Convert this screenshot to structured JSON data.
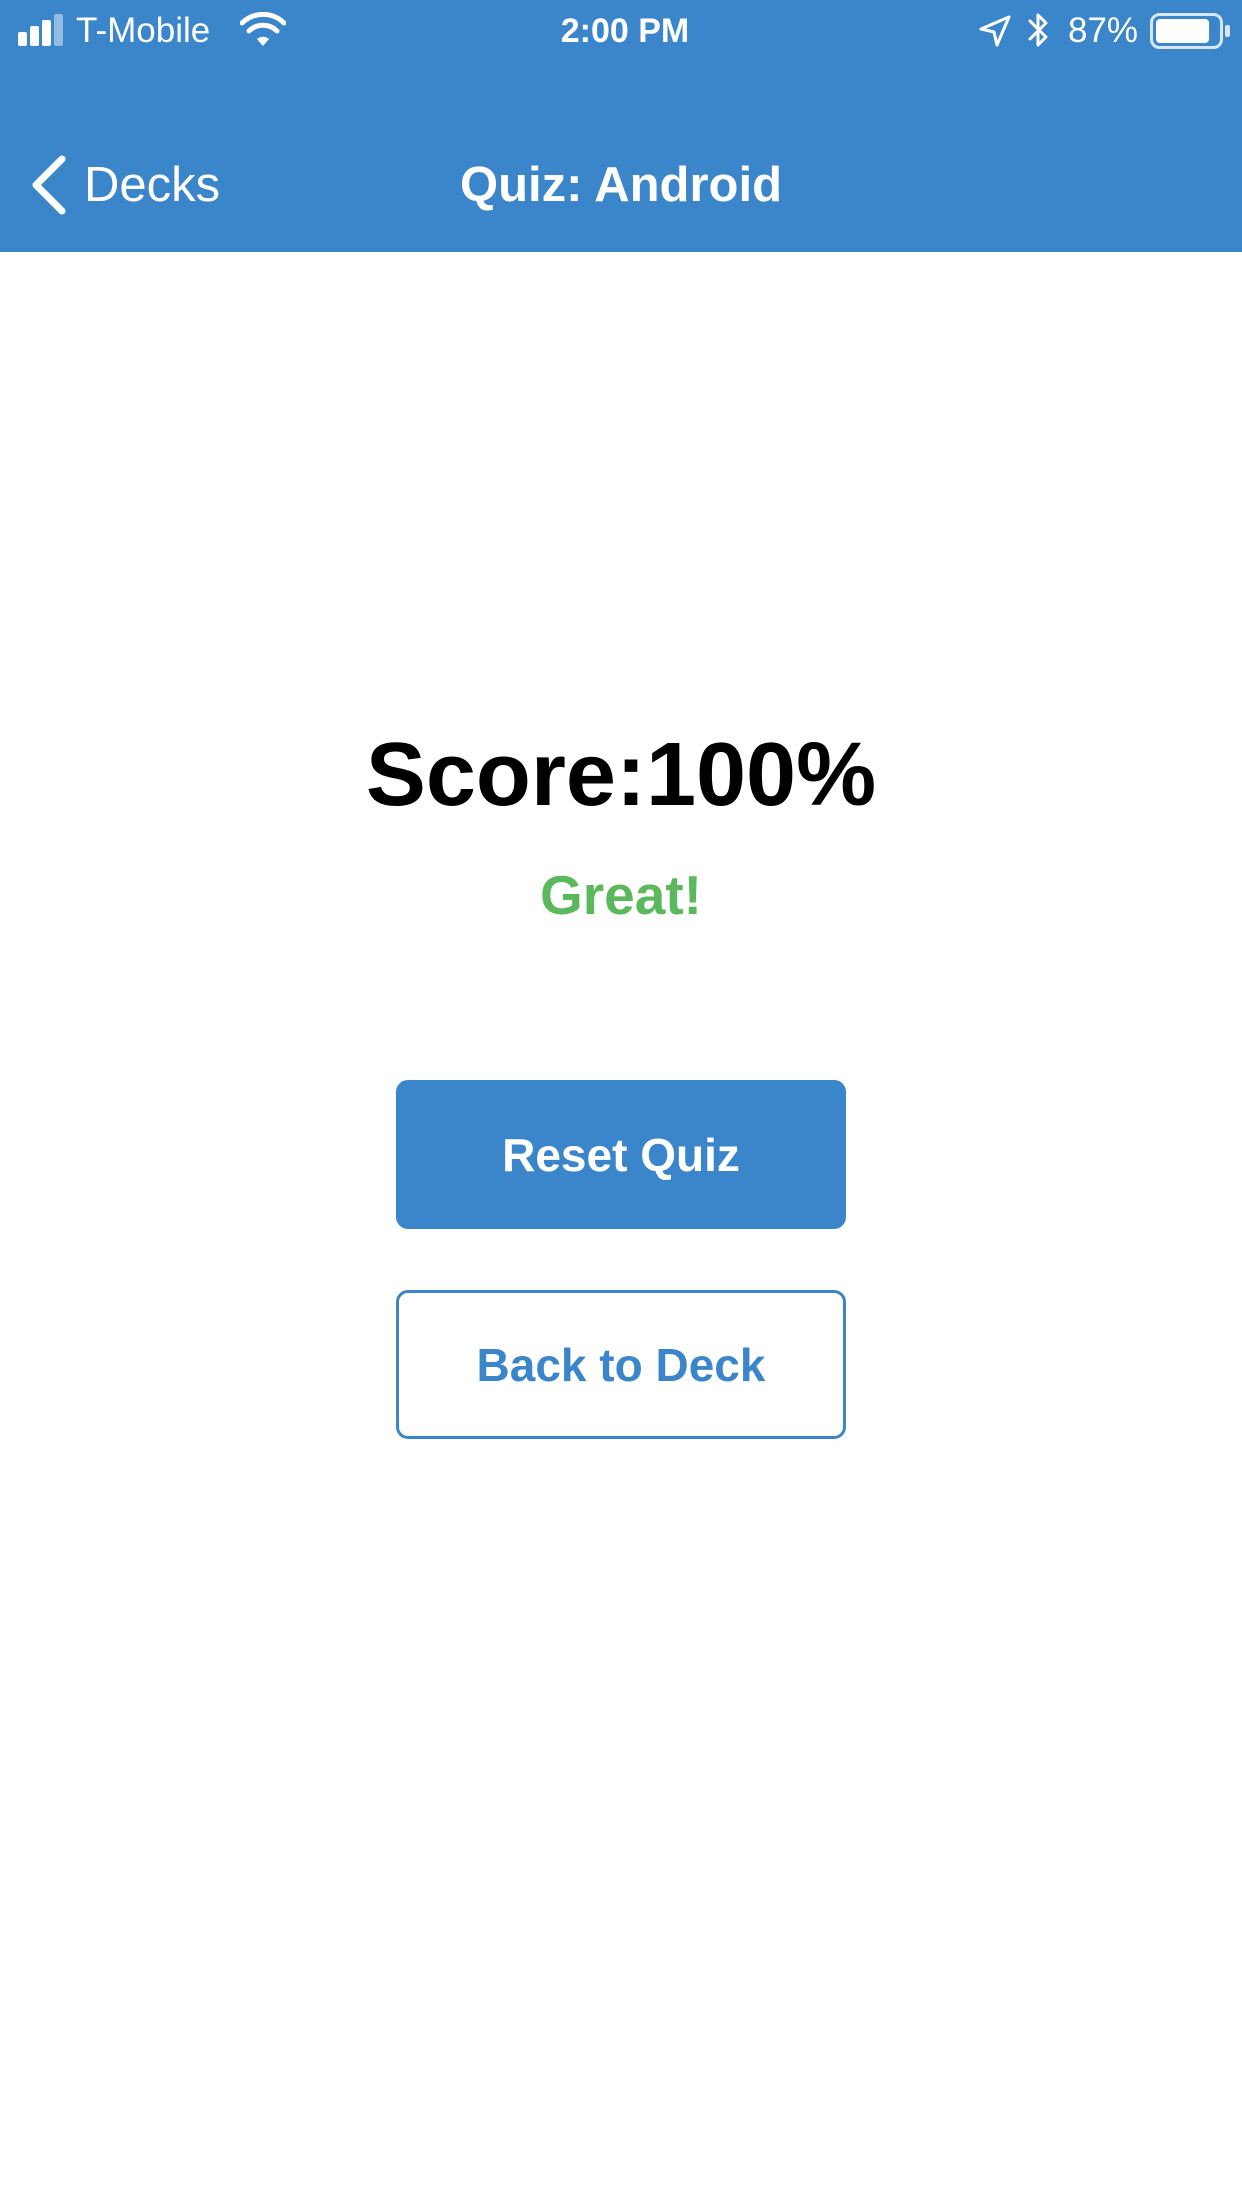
{
  "status_bar": {
    "carrier": "T-Mobile",
    "time": "2:00 PM",
    "battery_percent": "87%",
    "battery_level": 0.87,
    "icons": [
      "signal-icon",
      "wifi-icon",
      "location-icon",
      "bluetooth-icon",
      "battery-icon"
    ]
  },
  "nav": {
    "back_label": "Decks",
    "title": "Quiz: Android"
  },
  "result": {
    "score_text": "Score:100%",
    "feedback": "Great!"
  },
  "actions": {
    "reset_label": "Reset Quiz",
    "back_to_deck_label": "Back to Deck"
  },
  "colors": {
    "accent": "#3b86cb",
    "success": "#5cb85c",
    "background": "#ffffff"
  }
}
